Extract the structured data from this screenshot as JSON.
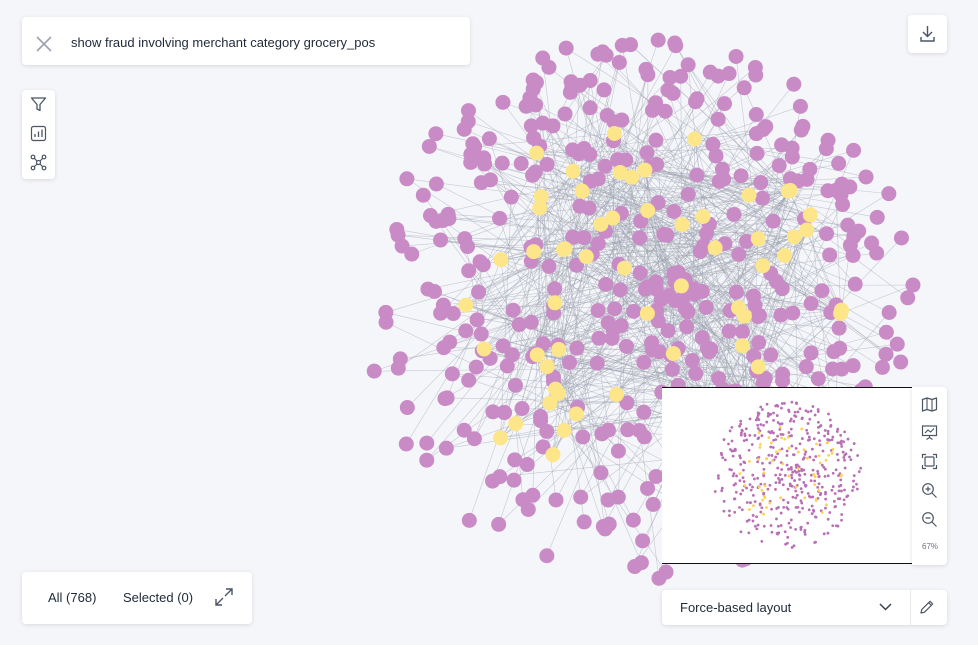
{
  "search": {
    "query": "show fraud involving merchant category grocery_pos"
  },
  "toolbar_left": {
    "icons": [
      "filter-icon",
      "bar-chart-icon",
      "graph-network-icon"
    ]
  },
  "toolbar_top_right": {
    "icons": [
      "download-icon"
    ]
  },
  "minimap_tools": {
    "icons": [
      "map-icon",
      "chart-presentation-icon",
      "fit-screen-icon",
      "zoom-in-icon",
      "zoom-out-icon"
    ],
    "zoom_level": "67%"
  },
  "layout_selector": {
    "selected": "Force-based layout"
  },
  "counts": {
    "all_label": "All (768)",
    "selected_label": "Selected (0)"
  },
  "graph": {
    "node_colors": {
      "purple": "#c98bc6",
      "yellow": "#fde68a"
    },
    "edge_color": "#9ca3af",
    "total_nodes": 768
  }
}
